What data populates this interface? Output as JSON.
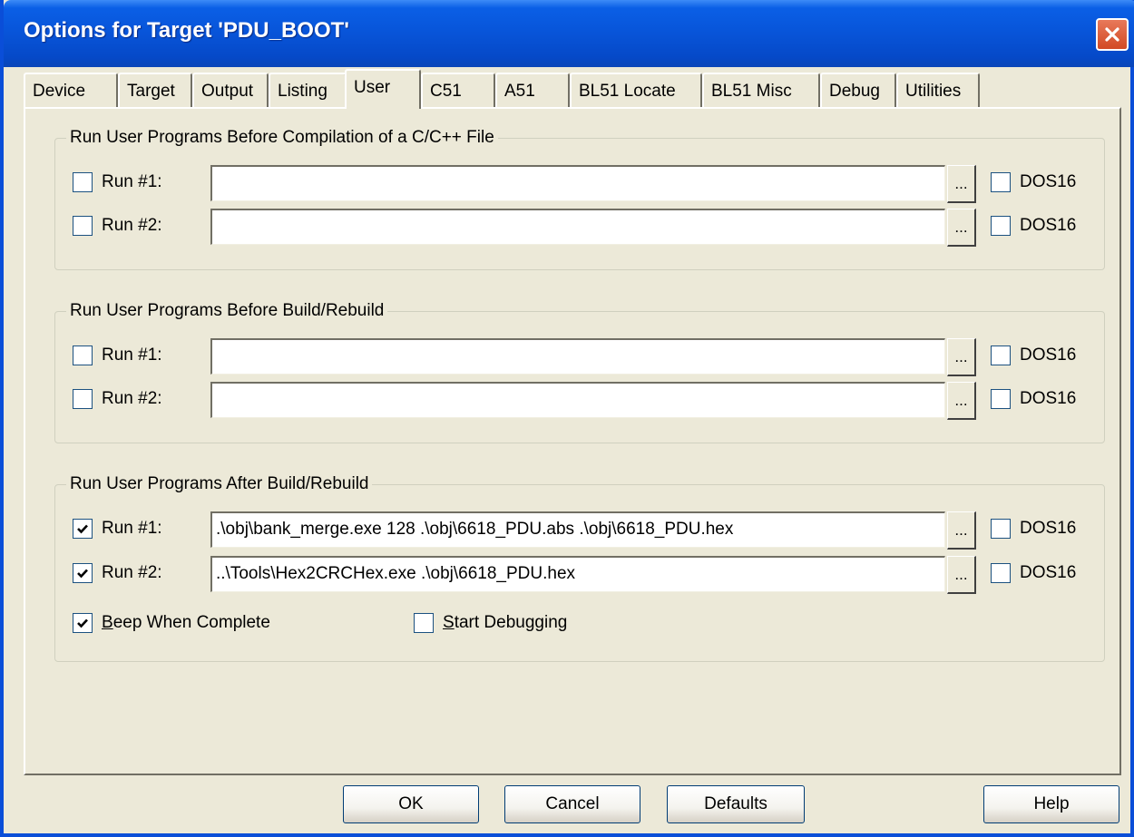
{
  "window": {
    "title": "Options for Target 'PDU_BOOT'"
  },
  "tabs": [
    {
      "label": "Device"
    },
    {
      "label": "Target"
    },
    {
      "label": "Output"
    },
    {
      "label": "Listing"
    },
    {
      "label": "User",
      "active": true
    },
    {
      "label": "C51"
    },
    {
      "label": "A51"
    },
    {
      "label": "BL51 Locate"
    },
    {
      "label": "BL51 Misc"
    },
    {
      "label": "Debug"
    },
    {
      "label": "Utilities"
    }
  ],
  "groups": {
    "before_compile": {
      "title": "Run User Programs Before Compilation of a C/C++ File",
      "rows": [
        {
          "label": "Run #1:",
          "checked": false,
          "value": "",
          "dos16_label": "DOS16",
          "dos16": false
        },
        {
          "label": "Run #2:",
          "checked": false,
          "value": "",
          "dos16_label": "DOS16",
          "dos16": false
        }
      ]
    },
    "before_build": {
      "title": "Run User Programs Before Build/Rebuild",
      "rows": [
        {
          "label": "Run #1:",
          "checked": false,
          "value": "",
          "dos16_label": "DOS16",
          "dos16": false
        },
        {
          "label": "Run #2:",
          "checked": false,
          "value": "",
          "dos16_label": "DOS16",
          "dos16": false
        }
      ]
    },
    "after_build": {
      "title": "Run User Programs After Build/Rebuild",
      "rows": [
        {
          "label": "Run #1:",
          "checked": true,
          "value": ".\\obj\\bank_merge.exe 128 .\\obj\\6618_PDU.abs .\\obj\\6618_PDU.hex",
          "dos16_label": "DOS16",
          "dos16": false
        },
        {
          "label": "Run #2:",
          "checked": true,
          "value": "..\\Tools\\Hex2CRCHex.exe .\\obj\\6618_PDU.hex",
          "dos16_label": "DOS16",
          "dos16": false
        }
      ],
      "beep": {
        "label_first": "B",
        "label_rest": "eep When Complete",
        "checked": true
      },
      "start_debug": {
        "label_first": "S",
        "label_rest": "tart Debugging",
        "checked": false
      }
    }
  },
  "browse_label": "...",
  "buttons": {
    "ok": "OK",
    "cancel": "Cancel",
    "defaults": "Defaults",
    "help": "Help"
  },
  "colors": {
    "title_bar": "#0854d8",
    "dialog_bg": "#ece9d8",
    "close_button": "#d24a25"
  }
}
